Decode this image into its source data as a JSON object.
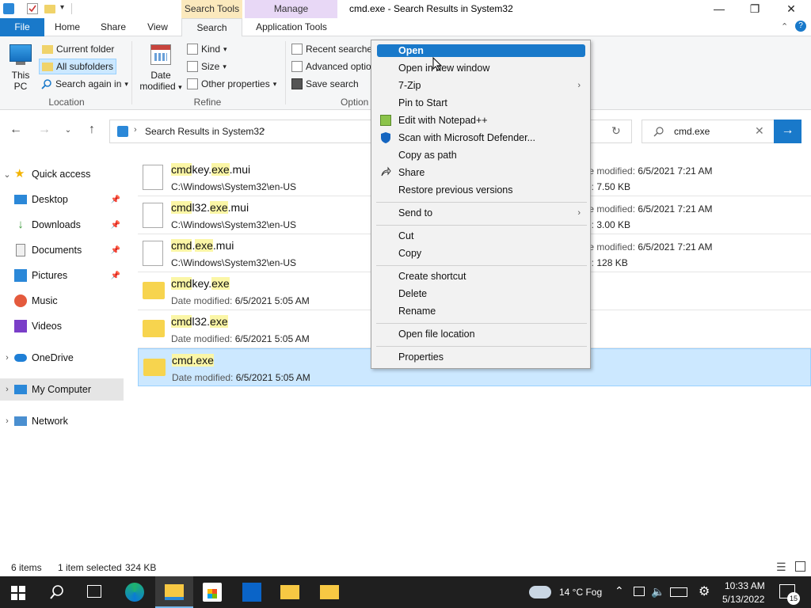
{
  "window": {
    "title": "cmd.exe - Search Results in System32",
    "context_tabs": {
      "search_tools": "Search Tools",
      "manage": "Manage"
    }
  },
  "ribbon_tabs": {
    "file": "File",
    "home": "Home",
    "share": "Share",
    "view": "View",
    "search": "Search",
    "application_tools": "Application Tools"
  },
  "ribbon": {
    "location": {
      "this_pc_line1": "This",
      "this_pc_line2": "PC",
      "current_folder": "Current folder",
      "all_subfolders": "All subfolders",
      "search_again_in": "Search again in",
      "label": "Location"
    },
    "refine": {
      "date_modified_line1": "Date",
      "date_modified_line2": "modified",
      "kind": "Kind",
      "size": "Size",
      "other_properties": "Other properties",
      "label": "Refine"
    },
    "options": {
      "recent_searches": "Recent searches",
      "advanced_options": "Advanced optio",
      "save_search": "Save search",
      "label": "Option"
    }
  },
  "address": {
    "path": "Search Results in System32",
    "search_query": "cmd.exe"
  },
  "nav": {
    "quick_access": "Quick access",
    "desktop": "Desktop",
    "downloads": "Downloads",
    "documents": "Documents",
    "pictures": "Pictures",
    "music": "Music",
    "videos": "Videos",
    "onedrive": "OneDrive",
    "my_computer": "My Computer",
    "network": "Network"
  },
  "files": [
    {
      "name_hl1": "cmd",
      "name_plain1": "key.",
      "name_hl2": "exe",
      "name_plain2": ".mui",
      "sub": "C:\\Windows\\System32\\en-US",
      "meta_label": "te modified:",
      "meta_date": "6/5/2021 7:21 AM",
      "size": "7.50 KB"
    },
    {
      "name_hl1": "cmd",
      "name_plain1": "l32.",
      "name_hl2": "exe",
      "name_plain2": ".mui",
      "sub": "C:\\Windows\\System32\\en-US",
      "meta_label": "te modified:",
      "meta_date": "6/5/2021 7:21 AM",
      "size": "3.00 KB"
    },
    {
      "name_hl1": "cmd",
      "name_plain1": ".",
      "name_hl2": "exe",
      "name_plain2": ".mui",
      "sub": "C:\\Windows\\System32\\en-US",
      "meta_label": "te modified:",
      "meta_date": "6/5/2021 7:21 AM",
      "size": "128 KB"
    },
    {
      "name_hl1": "cmd",
      "name_plain1": "key.",
      "name_hl2": "exe",
      "name_plain2": "",
      "sub_label": "Date modified:",
      "sub_date": "6/5/2021 5:05 AM"
    },
    {
      "name_hl1": "cmd",
      "name_plain1": "l32.",
      "name_hl2": "exe",
      "name_plain2": "",
      "sub_label": "Date modified:",
      "sub_date": "6/5/2021 5:05 AM"
    },
    {
      "name_hl1": "cmd.exe",
      "name_plain1": "",
      "name_hl2": "",
      "name_plain2": "",
      "sub_label": "Date modified:",
      "sub_date": "6/5/2021 5:05 AM"
    }
  ],
  "context_menu": {
    "open": "Open",
    "open_new_window": "Open in new window",
    "seven_zip": "7-Zip",
    "pin_to_start": "Pin to Start",
    "edit_notepad": "Edit with Notepad++",
    "scan_defender": "Scan with Microsoft Defender...",
    "copy_as_path": "Copy as path",
    "share": "Share",
    "restore_versions": "Restore previous versions",
    "send_to": "Send to",
    "cut": "Cut",
    "copy": "Copy",
    "create_shortcut": "Create shortcut",
    "delete": "Delete",
    "rename": "Rename",
    "open_file_location": "Open file location",
    "properties": "Properties"
  },
  "status": {
    "items": "6 items",
    "selected": "1 item selected",
    "size": "324 KB"
  },
  "taskbar": {
    "weather": "14 °C  Fog",
    "time": "10:33 AM",
    "date": "5/13/2022",
    "notif_count": "15"
  },
  "colors": {
    "accent": "#1979ca",
    "selection": "#cce8ff",
    "highlight": "#fbf6a6"
  }
}
